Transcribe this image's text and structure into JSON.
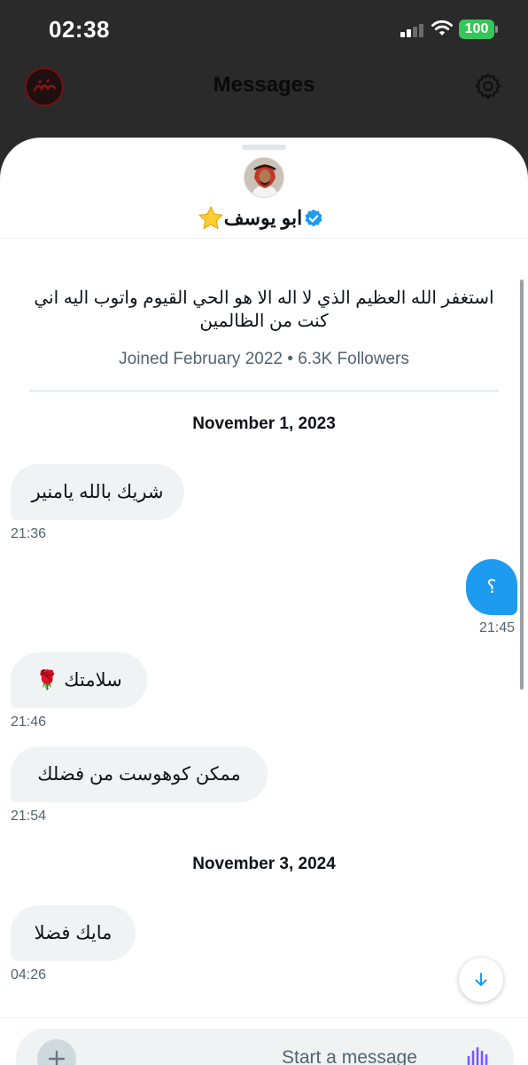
{
  "status_bar": {
    "time": "02:38",
    "battery": "100"
  },
  "header": {
    "title": "Messages"
  },
  "profile": {
    "name": "ابو يوسف",
    "bio": "استغفر الله العظيم الذي لا اله الا هو الحي القيوم واتوب اليه اني كنت من الظالمين",
    "meta": "Joined February 2022 • 6.3K Followers"
  },
  "conversation": {
    "dates": [
      "November 1, 2023",
      "November 3, 2024"
    ],
    "messages": [
      {
        "text": "شريك بالله يامنير",
        "time": "21:36",
        "direction": "incoming"
      },
      {
        "text": "؟",
        "time": "21:45",
        "direction": "outgoing"
      },
      {
        "text": "سلامتك 🌹",
        "time": "21:46",
        "direction": "incoming"
      },
      {
        "text": "ممكن كوهوست من فضلك",
        "time": "21:54",
        "direction": "incoming"
      },
      {
        "text": "مايك فضلا",
        "time": "04:26",
        "direction": "incoming"
      }
    ]
  },
  "composer": {
    "placeholder": "Start a message"
  },
  "icons": {
    "header_avatar": "logo-avatar-icon",
    "settings": "gear-icon",
    "verified": "verified-badge-icon",
    "star": "star-emoji-icon",
    "add": "plus-icon",
    "voice": "voice-waveform-icon",
    "scroll": "arrow-down-icon"
  },
  "colors": {
    "accent": "#1d9bf0",
    "incoming_bubble": "#eff3f4",
    "battery": "#34c759",
    "secondary_text": "#536471"
  }
}
